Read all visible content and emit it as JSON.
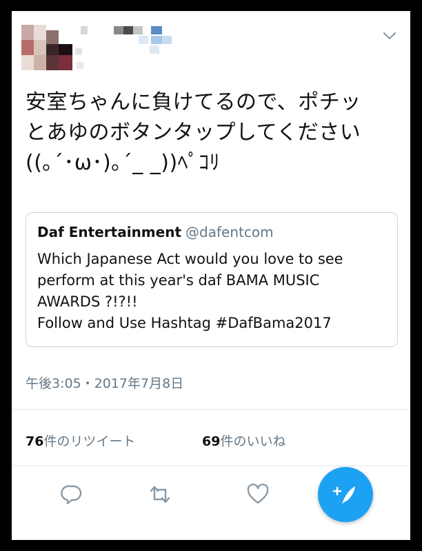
{
  "tweet": {
    "text": "安室ちゃんに負けてるので、ポチッ\nとあゆのボタンタップしてください\n((｡´･ω･)｡´_ _))ﾍﾟｺﾘ",
    "timestamp": "午後3:05・2017年7月8日"
  },
  "quoted_tweet": {
    "name": "Daf Entertainment",
    "handle": "@dafentcom",
    "text": "Which Japanese Act would you love to see\nperform at this year's daf BAMA MUSIC\nAWARDS ?!?!!\nFollow and Use Hashtag #DafBama2017"
  },
  "stats": {
    "retweet_count": "76",
    "retweet_label": "件のリツイート",
    "like_count": "69",
    "like_label": "件のいいね"
  },
  "icons": {
    "menu": "chevron-down-icon",
    "reply": "reply-icon",
    "retweet": "retweet-icon",
    "like": "heart-icon",
    "compose": "compose-tweet-icon"
  },
  "colors": {
    "accent": "#1da1f2",
    "secondary_text": "#657786",
    "border": "#ccd6dd"
  }
}
